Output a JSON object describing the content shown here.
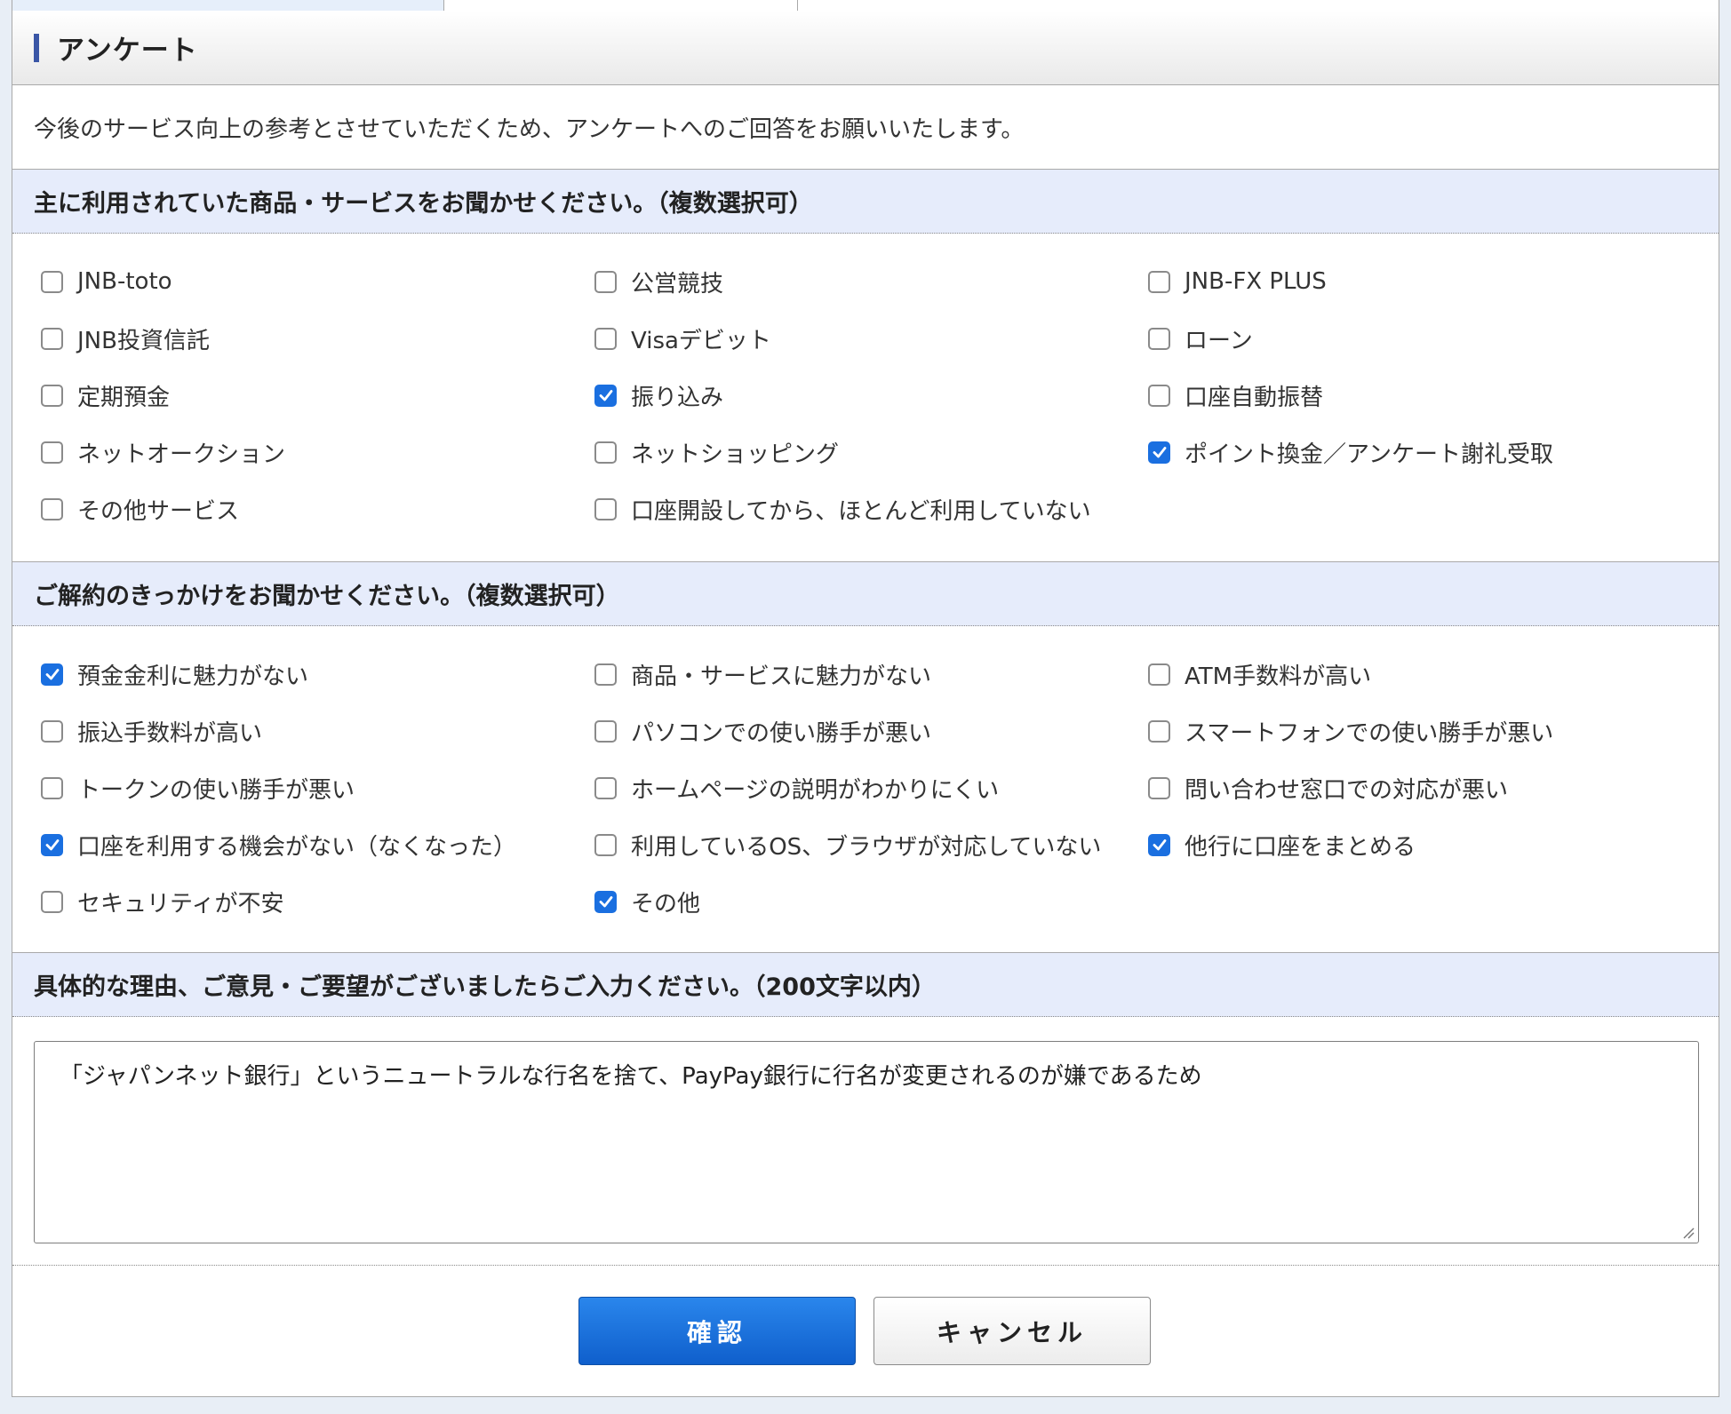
{
  "survey": {
    "title": "アンケート",
    "intro": "今後のサービス向上の参考とさせていただくため、アンケートへのご回答をお願いいたします。"
  },
  "q1": {
    "heading": "主に利用されていた商品・サービスをお聞かせください。（複数選択可）",
    "options": [
      {
        "label": "JNB-toto",
        "checked": false
      },
      {
        "label": "公営競技",
        "checked": false
      },
      {
        "label": "JNB-FX PLUS",
        "checked": false
      },
      {
        "label": "JNB投資信託",
        "checked": false
      },
      {
        "label": "Visaデビット",
        "checked": false
      },
      {
        "label": "ローン",
        "checked": false
      },
      {
        "label": "定期預金",
        "checked": false
      },
      {
        "label": "振り込み",
        "checked": true
      },
      {
        "label": "口座自動振替",
        "checked": false
      },
      {
        "label": "ネットオークション",
        "checked": false
      },
      {
        "label": "ネットショッピング",
        "checked": false
      },
      {
        "label": "ポイント換金／アンケート謝礼受取",
        "checked": true
      },
      {
        "label": "その他サービス",
        "checked": false
      },
      {
        "label": "口座開設してから、ほとんど利用していない",
        "checked": false
      }
    ]
  },
  "q2": {
    "heading": "ご解約のきっかけをお聞かせください。（複数選択可）",
    "options": [
      {
        "label": "預金金利に魅力がない",
        "checked": true
      },
      {
        "label": "商品・サービスに魅力がない",
        "checked": false
      },
      {
        "label": "ATM手数料が高い",
        "checked": false
      },
      {
        "label": "振込手数料が高い",
        "checked": false
      },
      {
        "label": "パソコンでの使い勝手が悪い",
        "checked": false
      },
      {
        "label": "スマートフォンでの使い勝手が悪い",
        "checked": false
      },
      {
        "label": "トークンの使い勝手が悪い",
        "checked": false
      },
      {
        "label": "ホームページの説明がわかりにくい",
        "checked": false
      },
      {
        "label": "問い合わせ窓口での対応が悪い",
        "checked": false
      },
      {
        "label": "口座を利用する機会がない（なくなった）",
        "checked": true
      },
      {
        "label": "利用しているOS、ブラウザが対応していない",
        "checked": false
      },
      {
        "label": "他行に口座をまとめる",
        "checked": true
      },
      {
        "label": "セキュリティが不安",
        "checked": false
      },
      {
        "label": "その他",
        "checked": true
      }
    ]
  },
  "q3": {
    "heading": "具体的な理由、ご意見・ご要望がございましたらご入力ください。（200文字以内）",
    "value": "「ジャパンネット銀行」というニュートラルな行名を捨て、PayPay銀行に行名が変更されるのが嫌であるため"
  },
  "buttons": {
    "confirm": "確認",
    "cancel": "キャンセル"
  },
  "colors": {
    "accent": "#3a56a6",
    "checkbox_checked": "#1a6fe0",
    "question_header_bg": "#e6ecfb",
    "confirm_button": "#1a6fe0"
  },
  "icons": {
    "checkmark": "check-icon",
    "resize": "resize-grip-icon"
  }
}
